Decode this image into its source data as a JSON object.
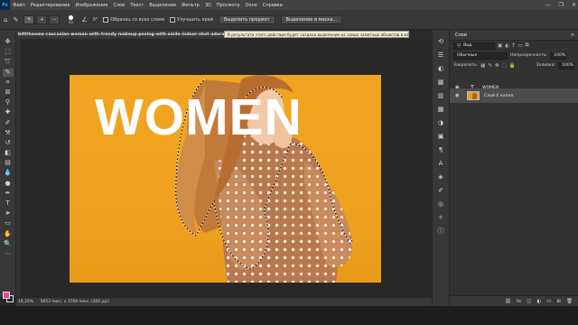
{
  "app": {
    "logo": "Ps",
    "menu": [
      "Файл",
      "Редактирование",
      "Изображение",
      "Слои",
      "Текст",
      "Выделение",
      "Фильтр",
      "3D",
      "Просмотр",
      "Окно",
      "Справка"
    ],
    "window_controls": [
      "—",
      "❐",
      "✕"
    ]
  },
  "options": {
    "brush_size": "15",
    "angle": "0°",
    "sample_all_layers": "Образец со всех слоев",
    "enhance_edge": "Улучшить край",
    "select_subject": "Выделить предмет",
    "select_and_mask": "Выделение и маска..."
  },
  "document": {
    "tab_title": "bitttheome-caucasian-woman-with-trendy-makeup-posing-with-smile-indoor-shot-adorable-white-lady",
    "tooltip": "В результате этого действия будет создано выделение из самых заметных объектов в изображении.",
    "headline": "WOMEN"
  },
  "status": {
    "zoom": "16,33%",
    "dimensions": "5653 пикс. x 3769 пикс. (300 ppi)"
  },
  "layers_panel": {
    "title": "Слои",
    "search": "Вид",
    "blend_mode": "Обычные",
    "opacity_label": "Непрозрачность:",
    "opacity_value": "100%",
    "lock_label": "Закрепить:",
    "fill_label": "Заливка:",
    "fill_value": "100%",
    "layers": [
      {
        "name": "WOMEN",
        "kind": "text",
        "visible": true
      },
      {
        "name": "Слой 0 копия",
        "kind": "image",
        "visible": true
      }
    ]
  },
  "colors": {
    "foreground": "#e84a9a",
    "background": "#2a2a2a",
    "canvas_orange": "#f0a522"
  }
}
